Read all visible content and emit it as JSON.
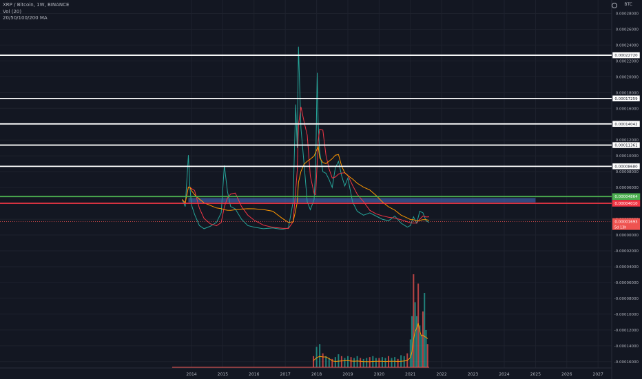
{
  "header": {
    "title": "XRP / Bitcoin, 1W, BINANCE",
    "volume": "Vol (20)",
    "ma": "20/50/100/200 MA"
  },
  "axis_unit": "BTC",
  "colors": {
    "background": "#131722",
    "grid": "#1e222d",
    "text": "#b2b5be",
    "up": "#26a69a",
    "down": "#ef5350",
    "white_level": "#ffffff",
    "green_level": "#4caf50",
    "red_level": "#f23645",
    "zone": "#3f5fa8",
    "ma1": "#f23645",
    "ma2": "#ff9800"
  },
  "chart_data": {
    "type": "line",
    "title": "XRP / Bitcoin, 1W, BINANCE",
    "x_ticks": [
      "2014",
      "2015",
      "2016",
      "2017",
      "2018",
      "2019",
      "2020",
      "2021",
      "2022",
      "2023",
      "2024",
      "2025",
      "2026",
      "2027"
    ],
    "y_ticks": [
      "0.00028000",
      "0.00026000",
      "0.00024000",
      "0.00022000",
      "0.00020000",
      "0.00018000",
      "0.00016000",
      "0.00012000",
      "0.00010000",
      "0.00008000",
      "0.00006000",
      "0.00002000",
      "0.00000000",
      "-0.00002000",
      "-0.00004000",
      "-0.00006000",
      "-0.00008000",
      "-0.00010000",
      "-0.00012000",
      "-0.00014000",
      "-0.00016000"
    ],
    "ylim": [
      -0.000168,
      0.00029
    ],
    "horizontal_levels": [
      {
        "label": "0.00022720",
        "value": 0.0002272,
        "color": "#ffffff"
      },
      {
        "label": "0.00017259",
        "value": 0.00017259,
        "color": "#ffffff"
      },
      {
        "label": "0.00014042",
        "value": 0.00014042,
        "color": "#ffffff"
      },
      {
        "label": "0.00011361",
        "value": 0.00011361,
        "color": "#ffffff"
      },
      {
        "label": "0.00008680",
        "value": 8.68e-05,
        "color": "#ffffff"
      },
      {
        "label": "0.00004864",
        "value": 4.864e-05,
        "color": "#4caf50"
      },
      {
        "label": "0.00004010",
        "value": 4.01e-05,
        "color": "#f23645"
      }
    ],
    "zone": {
      "from": 4.12e-05,
      "to": 4.68e-05,
      "x_start": "2013.9",
      "x_end": "2025.0"
    },
    "current_price": {
      "label": "0.00001693",
      "countdown": "5d 13h",
      "value": 1.693e-05
    },
    "series": [
      {
        "x": [
          2013.7,
          2013.8,
          2013.9,
          2013.95,
          2014.0,
          2014.1,
          2014.25,
          2014.4,
          2014.6,
          2014.8,
          2014.95,
          2015.05,
          2015.15,
          2015.25,
          2015.4,
          2015.6,
          2015.8,
          2016.0,
          2016.3,
          2016.6,
          2016.9,
          2017.1,
          2017.25,
          2017.33,
          2017.38,
          2017.42,
          2017.5,
          2017.6,
          2017.7,
          2017.8,
          2017.92,
          2017.97,
          2018.02,
          2018.05,
          2018.1,
          2018.2,
          2018.3,
          2018.4,
          2018.5,
          2018.6,
          2018.7,
          2018.8,
          2018.9,
          2019.0,
          2019.15,
          2019.3,
          2019.5,
          2019.7,
          2019.9,
          2020.1,
          2020.3,
          2020.5,
          2020.7,
          2020.9,
          2021.0,
          2021.1,
          2021.2,
          2021.3,
          2021.4,
          2021.5,
          2021.6
        ],
        "y": [
          4.5e-05,
          3.6e-05,
          0.000101,
          6e-05,
          3.8e-05,
          2.6e-05,
          1.2e-05,
          8e-06,
          1.1e-05,
          1.6e-05,
          2.8e-05,
          8.8e-05,
          5.5e-05,
          3.6e-05,
          3.3e-05,
          2e-05,
          1.2e-05,
          1e-05,
          8e-06,
          9e-06,
          7e-06,
          9e-06,
          4.2e-05,
          0.000165,
          0.00011,
          0.000238,
          0.000135,
          9e-05,
          4.2e-05,
          3.2e-05,
          4.5e-05,
          8.5e-05,
          0.000205,
          0.00014,
          0.000105,
          8e-05,
          7.8e-05,
          7e-05,
          6e-05,
          8.5e-05,
          9.3e-05,
          7.5e-05,
          6.2e-05,
          7.2e-05,
          4.2e-05,
          3e-05,
          2.5e-05,
          2.8e-05,
          2.4e-05,
          2e-05,
          1.8e-05,
          2.4e-05,
          1.5e-05,
          1e-05,
          1.2e-05,
          2.3e-05,
          1.5e-05,
          3e-05,
          2.8e-05,
          1.8e-05,
          1.6e-05
        ]
      }
    ],
    "volume": {
      "ylim": [
        0,
        1
      ],
      "x": [
        2017.9,
        2018.0,
        2018.1,
        2018.2,
        2018.3,
        2018.4,
        2018.5,
        2018.6,
        2018.7,
        2018.8,
        2018.9,
        2019.0,
        2019.1,
        2019.2,
        2019.3,
        2019.4,
        2019.5,
        2019.6,
        2019.7,
        2019.8,
        2019.9,
        2020.0,
        2020.1,
        2020.2,
        2020.3,
        2020.4,
        2020.5,
        2020.6,
        2020.7,
        2020.8,
        2020.9,
        2021.0,
        2021.05,
        2021.1,
        2021.15,
        2021.2,
        2021.25,
        2021.3,
        2021.35,
        2021.4,
        2021.45,
        2021.5,
        2021.55
      ],
      "values": [
        0.12,
        0.22,
        0.25,
        0.15,
        0.12,
        0.1,
        0.09,
        0.11,
        0.14,
        0.12,
        0.1,
        0.12,
        0.11,
        0.1,
        0.12,
        0.1,
        0.09,
        0.1,
        0.11,
        0.12,
        0.1,
        0.1,
        0.11,
        0.1,
        0.12,
        0.1,
        0.11,
        0.09,
        0.13,
        0.12,
        0.15,
        0.3,
        0.55,
        1.0,
        0.7,
        0.55,
        0.9,
        0.45,
        0.35,
        0.6,
        0.8,
        0.4,
        0.25
      ]
    }
  }
}
